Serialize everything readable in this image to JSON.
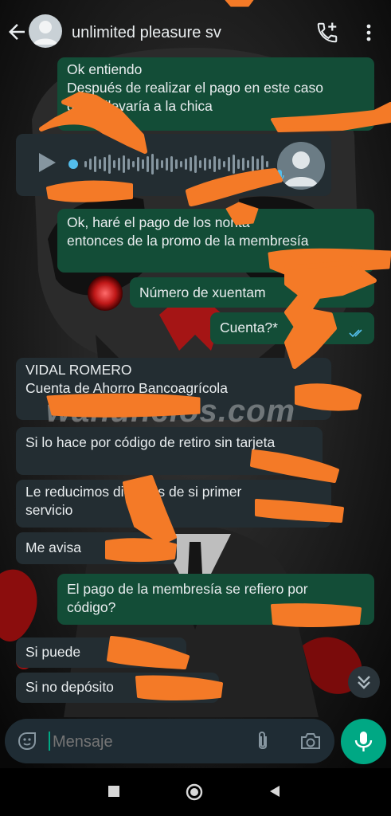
{
  "header": {
    "title": "unlimited pleasure sv"
  },
  "messages": [
    {
      "id": "m1",
      "dir": "out",
      "lines": [
        "Ok entiendo",
        "Después de realizar el pago en este caso",
        "de   se llevaría a la chica"
      ]
    },
    {
      "id": "m2",
      "dir": "in",
      "type": "voice"
    },
    {
      "id": "m3",
      "dir": "out",
      "lines": [
        "Ok, haré el pago de los       norita",
        "entonces de la promo de  la membresía"
      ]
    },
    {
      "id": "m4",
      "dir": "out",
      "lines": [
        "Número de xuentam"
      ]
    },
    {
      "id": "m5",
      "dir": "out",
      "lines": [
        "Cuenta?*"
      ]
    },
    {
      "id": "m6",
      "dir": "in",
      "lines": [
        "VIDAL ROMERO",
        "Cuenta de Ahorro Bancoagrícola"
      ]
    },
    {
      "id": "m7",
      "dir": "in",
      "lines": [
        "Si lo hace por código de retiro sin tarjeta"
      ]
    },
    {
      "id": "m8",
      "dir": "in",
      "lines": [
        "Le reducimos     dionales de si primer",
        "servicio"
      ]
    },
    {
      "id": "m9",
      "dir": "in",
      "lines": [
        "Me avisa"
      ]
    },
    {
      "id": "m10",
      "dir": "out",
      "lines": [
        "El pago de la membresía se refiero por",
        "código?"
      ]
    },
    {
      "id": "m11",
      "dir": "in",
      "lines": [
        "Si puede"
      ]
    },
    {
      "id": "m12",
      "dir": "in",
      "lines": [
        "Si no depósito"
      ]
    }
  ],
  "watermark": "wanuncios.com",
  "composer": {
    "placeholder": "Mensaje"
  },
  "colors": {
    "outgoing_bubble": "#134d37",
    "incoming_bubble": "#232d32",
    "accent": "#00a884",
    "read_ticks": "#53bdeb",
    "redaction": "#f47a27"
  },
  "icons": [
    "back-arrow-icon",
    "avatar-icon",
    "add-call-icon",
    "more-vert-icon",
    "play-icon",
    "sticker-icon",
    "attach-icon",
    "camera-icon",
    "mic-icon",
    "double-chevron-down-icon",
    "nav-recents-icon",
    "nav-home-icon",
    "nav-back-icon"
  ]
}
